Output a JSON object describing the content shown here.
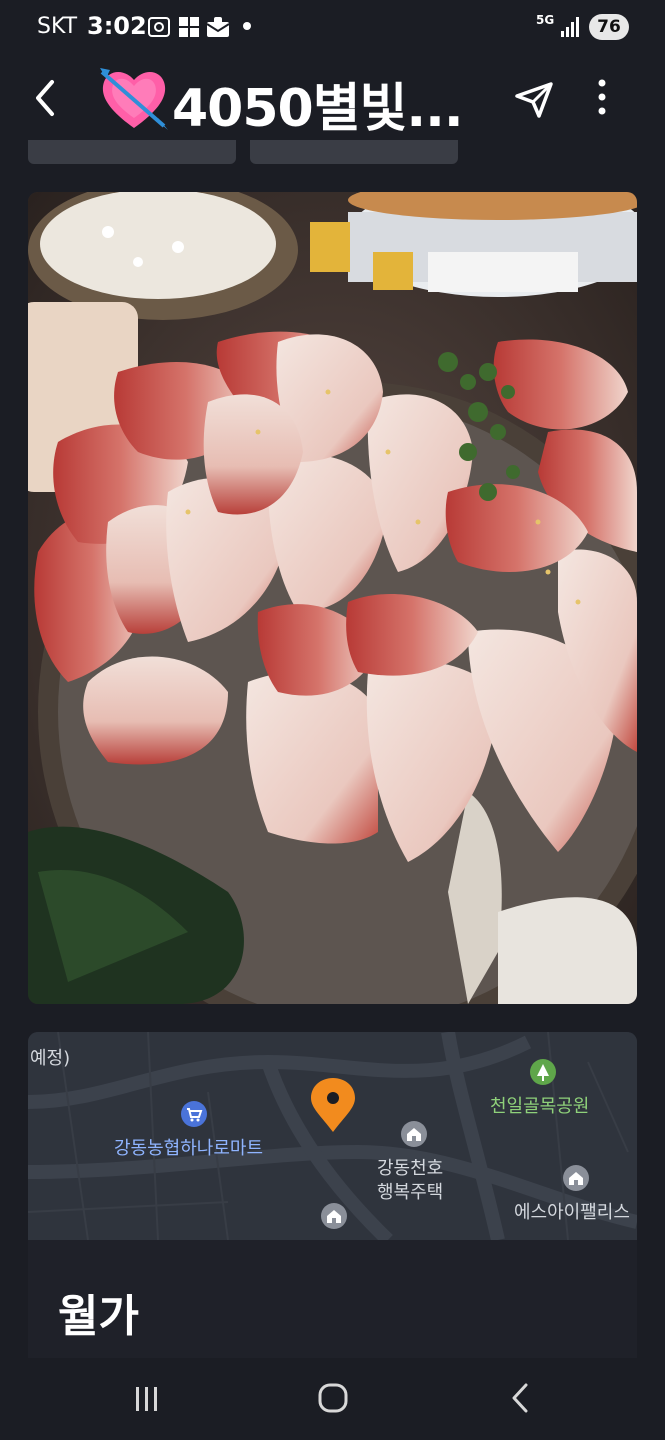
{
  "status_bar": {
    "carrier": "SKT",
    "time": "3:02",
    "network": "5G",
    "battery": "76"
  },
  "header": {
    "title": "4050별빛..."
  },
  "place": {
    "name": "월가"
  },
  "map": {
    "labels": {
      "top_left": "예정)",
      "mart": "강동농협하나로마트",
      "park": "천일골목공원",
      "house_line1": "강동천호",
      "house_line2": "행복주택",
      "palace": "에스아이팰리스"
    }
  },
  "colors": {
    "background": "#1b1d24",
    "pin": "#f28b1e",
    "map_bg": "#2f343d"
  }
}
